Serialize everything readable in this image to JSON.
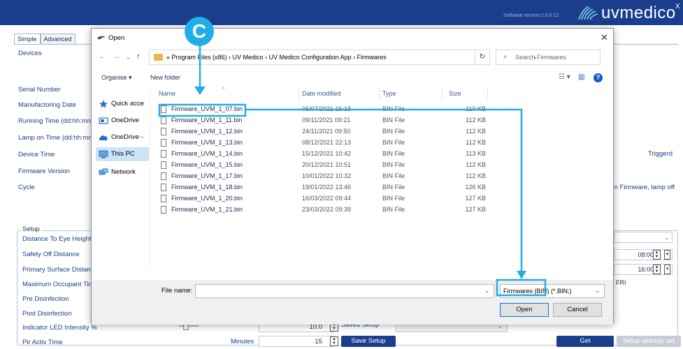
{
  "app": {
    "software_version": "Software version:1.0.0.12",
    "logo_text": "uvmedico",
    "close_glyph": "X",
    "header_color": "#1a3e8c",
    "tabs": [
      {
        "label": "Simple"
      },
      {
        "label": "Advanced"
      }
    ]
  },
  "device_info": {
    "devices_label": "Devices",
    "fields": [
      {
        "label": "Serial Number"
      },
      {
        "label": "Manufactoring Date"
      },
      {
        "label": "Running Time (dd:hh:mn"
      },
      {
        "label": "Lamp on Time (dd:hh:mn"
      },
      {
        "label": "Device Time"
      },
      {
        "label": "Firmware Version"
      },
      {
        "label": "Cycle"
      }
    ],
    "triggerd": "Triggerd",
    "cycle_note": "In Firmware, lamp off"
  },
  "setup": {
    "legend": "Setup",
    "fields": [
      {
        "label": "Distance To Eye Height"
      },
      {
        "label": "Safety Off Distance"
      },
      {
        "label": "Primary Surface Distanc"
      },
      {
        "label": "Maximum Occupant Tir"
      },
      {
        "label": "Pre Disinfection"
      },
      {
        "label": "Post Disinfection"
      },
      {
        "label": "Indicator LED Intensity %"
      },
      {
        "label": "Pir Activ Time"
      }
    ],
    "time_start": "08:00",
    "time_end": "16:00",
    "fri_label": "FRI",
    "fri_checked": "✓",
    "led_intensity": "10.0",
    "minutes_label": "Minutes",
    "pir_minutes": "15",
    "saved_setup_label": "Saved Setup",
    "save_setup_button": "Save Setup",
    "get_button": "Get",
    "setup_already_set_button": "Setup already set"
  },
  "dialog": {
    "title": "Open",
    "close_glyph": "✕",
    "breadcrumb": "« Program Files (x86) › UV Medico › UV Medico Configuration App › Firmwares",
    "search_placeholder": "Search Firmwares",
    "organise_label": "Organise ▾",
    "new_folder_label": "New folder",
    "nav_items": [
      {
        "label": "Quick acce",
        "icon": "star-icon"
      },
      {
        "label": "OneDrive",
        "icon": "onedrive-icon"
      },
      {
        "label": "OneDrive -",
        "icon": "cloud-icon"
      },
      {
        "label": "This PC",
        "icon": "computer-icon"
      },
      {
        "label": "Network",
        "icon": "network-icon"
      }
    ],
    "columns": {
      "name": "Name",
      "date": "Date modified",
      "type": "Type",
      "size": "Size"
    },
    "files": [
      {
        "name": "Firmware_UVM_1_07.bin",
        "date": "06/07/2021 15:18",
        "type": "BIN File",
        "size": "110 KB"
      },
      {
        "name": "Firmware_UVM_1_11.bin",
        "date": "09/11/2021 09:21",
        "type": "BIN File",
        "size": "112 KB"
      },
      {
        "name": "Firmware_UVM_1_12.bin",
        "date": "24/11/2021 09:50",
        "type": "BIN File",
        "size": "112 KB"
      },
      {
        "name": "Firmware_UVM_1_13.bin",
        "date": "08/12/2021 22:13",
        "type": "BIN File",
        "size": "112 KB"
      },
      {
        "name": "Firmware_UVM_1_14.bin",
        "date": "15/12/2021 10:42",
        "type": "BIN File",
        "size": "113 KB"
      },
      {
        "name": "Firmware_UVM_1_15.bin",
        "date": "20/12/2021 10:51",
        "type": "BIN File",
        "size": "112 KB"
      },
      {
        "name": "Firmware_UVM_1_17.bin",
        "date": "10/01/2022 10:32",
        "type": "BIN File",
        "size": "112 KB"
      },
      {
        "name": "Firmware_UVM_1_18.bin",
        "date": "19/01/2022 13:46",
        "type": "BIN File",
        "size": "126 KB"
      },
      {
        "name": "Firmware_UVM_1_20.bin",
        "date": "16/03/2022 09:44",
        "type": "BIN File",
        "size": "127 KB"
      },
      {
        "name": "Firmware_UVM_1_21.bin",
        "date": "23/03/2022 09:39",
        "type": "BIN File",
        "size": "127 KB"
      }
    ],
    "file_name_label": "File name:",
    "file_name_value": "",
    "file_type": "Firmwares (BIN) (*.BIN;)",
    "open_button": "Open",
    "cancel_button": "Cancel"
  },
  "annotation": {
    "badge_letter": "C",
    "color": "#20aee6"
  }
}
